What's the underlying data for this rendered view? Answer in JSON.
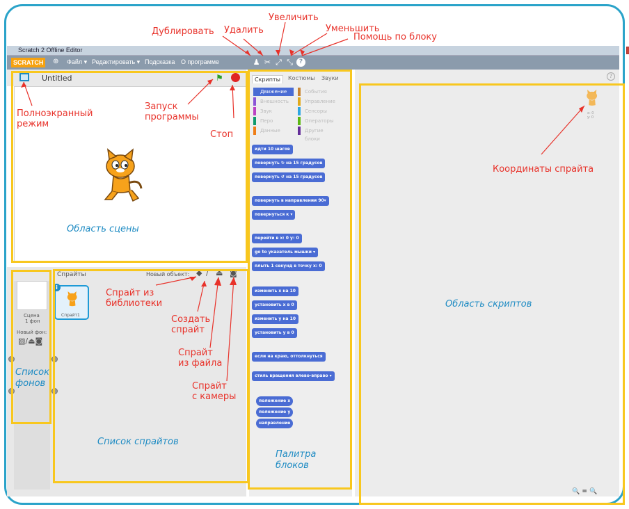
{
  "window": {
    "title": "Scratch 2 Offline Editor",
    "buttons": [
      "–",
      "□",
      "✕"
    ]
  },
  "menubar": {
    "logo": "SCRATCH",
    "items": [
      "Файл ▾",
      "Редактировать ▾",
      "Подсказка",
      "О программе"
    ],
    "tool_icons": [
      "duplicate-icon",
      "delete-icon",
      "grow-icon",
      "shrink-icon",
      "help-icon"
    ]
  },
  "stage": {
    "project_title": "Untitled"
  },
  "palette": {
    "tabs": [
      "Скрипты",
      "Костюмы",
      "Звуки"
    ],
    "categories": [
      {
        "label": "Движение",
        "color": "#4a6cd4"
      },
      {
        "label": "События",
        "color": "#c88330"
      },
      {
        "label": "Внешность",
        "color": "#8a55d7"
      },
      {
        "label": "Управление",
        "color": "#e1a91a"
      },
      {
        "label": "Звук",
        "color": "#bb42c3"
      },
      {
        "label": "Сенсоры",
        "color": "#2ca5e2"
      },
      {
        "label": "Перо",
        "color": "#0e9a6c"
      },
      {
        "label": "Операторы",
        "color": "#5cb712"
      },
      {
        "label": "Данные",
        "color": "#ee7d16"
      },
      {
        "label": "Другие блоки",
        "color": "#632d99"
      }
    ],
    "blocks": [
      "идти 10 шагов",
      "повернуть ↻ на 15 градусов",
      "повернуть ↺ на 15 градусов",
      "повернуть в направлении 90▾",
      "повернуться к ▾",
      "перейти в x: 0 y: 0",
      "go to указатель мышки ▾",
      "плыть 1 секунд в точку x: 0",
      "изменить x на 10",
      "установить x в 0",
      "изменить y на 10",
      "установить y в 0",
      "если на краю, оттолкнуться",
      "стиль вращения влево-вправо ▾"
    ],
    "reporters": [
      "положение x",
      "положение y",
      "направление"
    ]
  },
  "sprites_panel": {
    "header": "Спрайты",
    "new_object_label": "Новый объект:",
    "stage_label_line1": "Сцена",
    "stage_label_line2": "1 фон",
    "new_backdrop_label": "Новый фон:",
    "sprite_name": "Спрайт1"
  },
  "scripts_area": {
    "sprite_coords_x": "x: 0",
    "sprite_coords_y": "y: 0",
    "zoom_controls": "🔍 = 🔍"
  },
  "annotations": {
    "duplicate": "Дублировать",
    "delete": "Удалить",
    "grow": "Увеличить",
    "shrink": "Уменьшить",
    "block_help": "Помощь по блоку",
    "fullscreen": "Полноэкранный\nрежим",
    "run": "Запуск\nпрограммы",
    "stop": "Стоп",
    "stage_area": "Область сцены",
    "sprite_library": "Спрайт из\nбиблиотеки",
    "create_sprite": "Создать\nспрайт",
    "sprite_from_file": "Спрайт\nиз файла",
    "sprite_from_camera": "Спрайт\nс камеры",
    "backdrop_list": "Список\nфонов",
    "sprite_list": "Список спрайтов",
    "block_palette": "Палитра\nблоков",
    "script_area": "Область скриптов",
    "sprite_coords": "Координаты спрайта"
  },
  "colors": {
    "frame": "#2aa3c9",
    "highlight_box": "#f8c71e",
    "callout_red": "#e8322a",
    "callout_blue": "#1e8bc3",
    "motion_block": "#4a6cd4"
  }
}
